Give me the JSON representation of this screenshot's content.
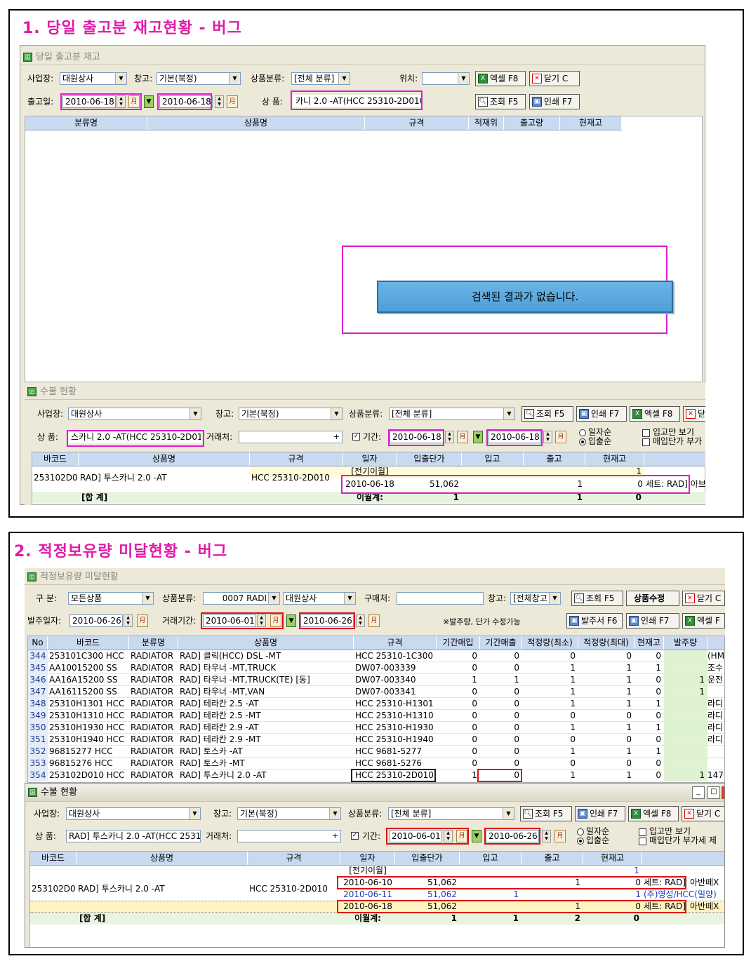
{
  "section1": {
    "heading": "1. 당일 출고분 재고현황 - 버그",
    "window_title": "당일 출고분 재고",
    "labels": {
      "business": "사업장:",
      "warehouse": "창고:",
      "category": "상품분류:",
      "location": "위치:",
      "ship_date": "출고일:",
      "product": "상  품:"
    },
    "values": {
      "business": "대원상사",
      "warehouse": "기본(북정)",
      "category": "[전체 분류]",
      "location": "",
      "date_from": "2010-06-18",
      "date_to": "2010-06-18",
      "product": "카니 2.0 -AT(HCC 25310-2D010)"
    },
    "buttons": {
      "excel": "엑셀 F8",
      "close": "닫기 C",
      "search": "조회 F5",
      "print": "인쇄 F7"
    },
    "columns": [
      "분류명",
      "상품명",
      "규격",
      "적재위",
      "출고량",
      "현재고"
    ],
    "empty_message": "검색된 결과가 없습니다.",
    "sub": {
      "title": "수불 현황",
      "labels": {
        "business": "사업장:",
        "warehouse": "창고:",
        "category": "상품분류:",
        "product": "상  품:",
        "vendor": "거래처:",
        "period": "기간:",
        "by_date": "일자순",
        "by_io": "입출순",
        "in_only": "입고만 보기",
        "vat": "매입단가 부가"
      },
      "values": {
        "business": "대원상사",
        "warehouse": "기본(북정)",
        "category": "[전체 분류]",
        "product": "스카니 2.0 -AT(HCC 25310-2D010)",
        "vendor": "",
        "date_from": "2010-06-18",
        "date_to": "2010-06-18"
      },
      "buttons": {
        "search": "조회 F5",
        "print": "인쇄 F7",
        "excel": "엑셀 F8",
        "close": "닫"
      },
      "columns": [
        "바코드",
        "상품명",
        "규격",
        "일자",
        "입출단가",
        "입고",
        "출고",
        "현재고"
      ],
      "row": {
        "barcode": "253102D01",
        "name": "RAD] 투스카니 2.0 -AT",
        "spec": "HCC 25310-2D010"
      },
      "carry": {
        "label": "[전기이월]",
        "stock": "1"
      },
      "entry": {
        "date": "2010-06-18",
        "price": "51,062",
        "in": "",
        "out": "1",
        "stock": "0",
        "note": "세트: RAD] 아브"
      },
      "total": {
        "label": "[합 계]",
        "sub_label": "이월계:",
        "in": "1",
        "out": "1",
        "stock": "0"
      }
    }
  },
  "section2": {
    "heading": "2. 적정보유량 미달현황 - 버그",
    "window_title": "적정보유량 미달현황",
    "labels": {
      "type": "구  분:",
      "category": "상품분류:",
      "buyer": "구매처:",
      "warehouse": "창고:",
      "order_date": "발주일자:",
      "trade_period": "거래기간:",
      "note": "※발주량, 단가 수정가능"
    },
    "values": {
      "type": "모든상품",
      "category": "0007 RADI",
      "business": "대원상사",
      "buyer": "",
      "warehouse": "[전체창고",
      "order_date": "2010-06-26",
      "date_from": "2010-06-01",
      "date_to": "2010-06-26"
    },
    "buttons": {
      "search": "조회 F5",
      "edit": "상품수정",
      "close": "닫기 C",
      "order": "발주서 F6",
      "print": "인쇄 F7",
      "excel": "엑셀 F"
    },
    "columns": [
      "No",
      "바코드",
      "분류명",
      "상품명",
      "규격",
      "기간매입",
      "기간매출",
      "적정량(최소)",
      "적정량(최대)",
      "현재고",
      "발주량",
      ""
    ],
    "rows": [
      {
        "no": "344",
        "barcode": "253101C300 HCC",
        "cat": "RADIATOR",
        "name": "RAD] 클릭(HCC) DSL -MT",
        "spec": "HCC 25310-1C300",
        "buy": "0",
        "sell": "0",
        "min": "0",
        "max": "0",
        "stock": "0",
        "order": "",
        "extra": "(HM"
      },
      {
        "no": "345",
        "barcode": "AA10015200 SS",
        "cat": "RADIATOR",
        "name": "RAD] 타우너 -MT,TRUCK",
        "spec": "DW07-003339",
        "buy": "0",
        "sell": "0",
        "min": "1",
        "max": "1",
        "stock": "1",
        "order": "",
        "extra": "조수"
      },
      {
        "no": "346",
        "barcode": "AA16A15200 SS",
        "cat": "RADIATOR",
        "name": "RAD] 타우너 -MT,TRUCK(TE) [동]",
        "spec": "DW07-003340",
        "buy": "1",
        "sell": "1",
        "min": "1",
        "max": "1",
        "stock": "0",
        "order": "1",
        "extra": "운전"
      },
      {
        "no": "347",
        "barcode": "AA16115200 SS",
        "cat": "RADIATOR",
        "name": "RAD] 타우너 -MT,VAN",
        "spec": "DW07-003341",
        "buy": "0",
        "sell": "0",
        "min": "1",
        "max": "1",
        "stock": "0",
        "order": "1",
        "extra": ""
      },
      {
        "no": "348",
        "barcode": "25310H1301 HCC",
        "cat": "RADIATOR",
        "name": "RAD] 테라칸 2.5 -AT",
        "spec": "HCC 25310-H1301",
        "buy": "0",
        "sell": "0",
        "min": "1",
        "max": "1",
        "stock": "1",
        "order": "",
        "extra": "라디"
      },
      {
        "no": "349",
        "barcode": "25310H1310 HCC",
        "cat": "RADIATOR",
        "name": "RAD] 테라칸 2.5 -MT",
        "spec": "HCC 25310-H1310",
        "buy": "0",
        "sell": "0",
        "min": "0",
        "max": "0",
        "stock": "0",
        "order": "",
        "extra": "라디"
      },
      {
        "no": "350",
        "barcode": "25310H1930 HCC",
        "cat": "RADIATOR",
        "name": "RAD] 테라칸 2.9 -AT",
        "spec": "HCC 25310-H1930",
        "buy": "0",
        "sell": "0",
        "min": "1",
        "max": "1",
        "stock": "1",
        "order": "",
        "extra": "라디"
      },
      {
        "no": "351",
        "barcode": "25310H1940 HCC",
        "cat": "RADIATOR",
        "name": "RAD] 테라칸 2.9 -MT",
        "spec": "HCC 25310-H1940",
        "buy": "0",
        "sell": "0",
        "min": "0",
        "max": "0",
        "stock": "0",
        "order": "",
        "extra": "라디"
      },
      {
        "no": "352",
        "barcode": "96815277 HCC",
        "cat": "RADIATOR",
        "name": "RAD] 토스카 -AT",
        "spec": "HCC 9681-5277",
        "buy": "0",
        "sell": "0",
        "min": "1",
        "max": "1",
        "stock": "1",
        "order": "",
        "extra": ""
      },
      {
        "no": "353",
        "barcode": "96815276 HCC",
        "cat": "RADIATOR",
        "name": "RAD] 토스카 -MT",
        "spec": "HCC 9681-5276",
        "buy": "0",
        "sell": "0",
        "min": "0",
        "max": "0",
        "stock": "0",
        "order": "",
        "extra": ""
      },
      {
        "no": "354",
        "barcode": "253102D010 HCC",
        "cat": "RADIATOR",
        "name": "RAD] 투스카니 2.0 -AT",
        "spec": "HCC 25310-2D010",
        "buy": "1",
        "sell": "0",
        "min": "1",
        "max": "1",
        "stock": "0",
        "order": "1",
        "extra": "147"
      }
    ],
    "sub": {
      "title": "수불 현황",
      "labels": {
        "business": "사업장:",
        "warehouse": "창고:",
        "category": "상품분류:",
        "product": "상  품:",
        "vendor": "거래처:",
        "period": "기간:",
        "by_date": "일자순",
        "by_io": "입출순",
        "in_only": "입고만 보기",
        "vat": "매입단가 부가세 제"
      },
      "values": {
        "business": "대원상사",
        "warehouse": "기본(북정)",
        "category": "[전체 분류]",
        "product": "RAD] 투스카니 2.0 -AT(HCC 2531",
        "vendor": "",
        "date_from": "2010-06-01",
        "date_to": "2010-06-26"
      },
      "buttons": {
        "search": "조회 F5",
        "print": "인쇄 F7",
        "excel": "엑셀 F8",
        "close": "닫기 C"
      },
      "columns": [
        "바코드",
        "상품명",
        "규격",
        "일자",
        "입출단가",
        "입고",
        "출고",
        "현재고"
      ],
      "row": {
        "barcode": "253102D01",
        "name": "RAD] 투스카니 2.0 -AT",
        "spec": "HCC 25310-2D010"
      },
      "carry": {
        "label": "[전기이월]",
        "stock": "1"
      },
      "entries": [
        {
          "date": "2010-06-10",
          "price": "51,062",
          "in": "",
          "out": "1",
          "stock": "0",
          "note": "세트: RAD]",
          "note2": "아반떼X"
        },
        {
          "date": "2010-06-11",
          "price": "51,062",
          "in": "1",
          "out": "",
          "stock": "1",
          "note": "(주)영성/HCC(밀양)",
          "note2": ""
        },
        {
          "date": "2010-06-18",
          "price": "51,062",
          "in": "",
          "out": "1",
          "stock": "0",
          "note": "세트: RAD]",
          "note2": "아반떼X"
        }
      ],
      "total": {
        "label": "[합 계]",
        "sub_label": "이월계:",
        "in": "1",
        "in2": "1",
        "out": "2",
        "stock": "0"
      }
    }
  }
}
